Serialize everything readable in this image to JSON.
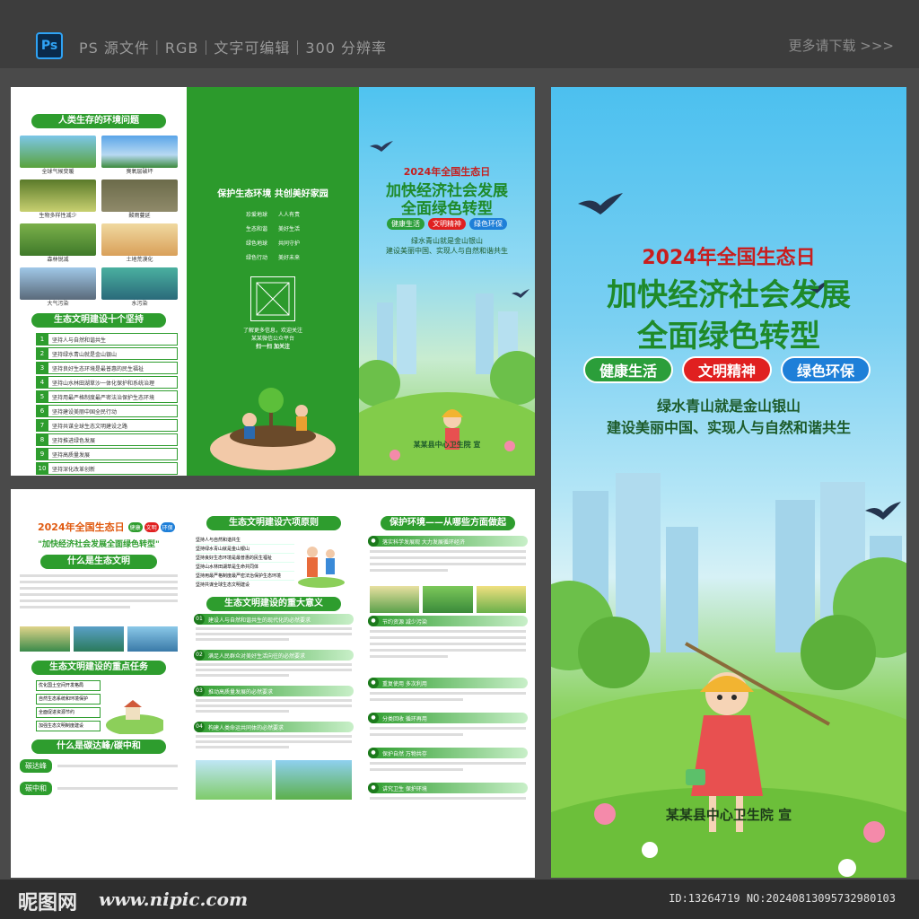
{
  "topbar": {
    "ps_badge": "Ps",
    "info": "PS 源文件｜RGB｜文字可编辑｜300 分辨率",
    "more": "更多请下载 >>>"
  },
  "bottombar": {
    "site_name": "昵图网",
    "site_url": "www.nipic.com",
    "id_text": "ID:13264719 NO:20240813095732980103"
  },
  "outside": {
    "left_panel": {
      "env_title": "人类生存的环境问题",
      "photos": [
        "全球气候变暖",
        "臭氧层破坏",
        "生物多样性减少",
        "酸雨蔓延",
        "森林锐减",
        "土地荒漠化",
        "大气污染",
        "水污染"
      ],
      "ten_title": "生态文明建设十个坚持",
      "ten_items": [
        "坚持人与自然和谐共生",
        "坚持绿水青山就是金山银山",
        "坚持良好生态环境是最普惠的民生福祉",
        "坚持山水林田湖草沙一体化保护和系统治理",
        "坚持用最严格制度最严密法治保护生态环境",
        "坚持建设美丽中国全民行动",
        "坚持共谋全球生态文明建设之路",
        "坚持推进绿色发展",
        "坚持高质量发展",
        "坚持深化改革创新"
      ]
    },
    "middle_panel": {
      "heading": "保护生态环境 共创美好家园",
      "pairs": [
        [
          "珍爱地球",
          "人人有责"
        ],
        [
          "生态和谐",
          "美好生活"
        ],
        [
          "绿色地球",
          "共同守护"
        ],
        [
          "绿色行动",
          "美好未来"
        ]
      ],
      "qr_note_1": "了解更多信息，欢迎关注",
      "qr_note_2": "某某微信公众平台",
      "qr_note_3": "扫一扫  加关注"
    },
    "cover_panel": {
      "year_title": "2024年全国生态日",
      "main_1": "加快经济社会发展",
      "main_2": "全面绿色转型",
      "tags": [
        "健康生活",
        "文明精神",
        "绿色环保"
      ],
      "slogan_1": "绿水青山就是金山银山",
      "slogan_2": "建设美丽中国、实现人与自然和谐共生",
      "issuer": "某某县中心卫生院  宣"
    }
  },
  "inside": {
    "p1": {
      "year_title": "2024年全国生态日",
      "badges": [
        "健康",
        "文明",
        "环保"
      ],
      "sub_title": "\"加快经济社会发展全面绿色转型\"",
      "what_title": "什么是生态文明",
      "key_title": "生态文明建设的重点任务",
      "key_items": [
        "优化国土空间开发格局",
        "自然生态系统和环境保护",
        "全面促进资源节约",
        "加强生态文明制度建设"
      ],
      "carbon_title": "什么是碳达峰/碳中和",
      "carbon_peak": "碳达峰",
      "carbon_neutral": "碳中和"
    },
    "p2": {
      "six_title": "生态文明建设六项原则",
      "six_items": [
        "坚持人与自然和谐共生",
        "坚持绿水青山就是金山银山",
        "坚持良好生态环境是最普惠的民生福祉",
        "坚持山水林田湖草是生命共同体",
        "坚持用最严格制度最严密法治保护生态环境",
        "坚持共谋全球生态文明建设"
      ],
      "meaning_title": "生态文明建设的重大意义",
      "meaning_items": [
        "建设人与自然和谐共生的现代化的必然要求",
        "满足人民群众对美好生活向往的必然要求",
        "推动高质量发展的必然要求",
        "构建人类命运共同体的必然要求"
      ]
    },
    "p3": {
      "protect_title": "保护环境——从哪些方面做起",
      "items": [
        "落实科学发展观  大力发展循环经济",
        "节约资源  减少污染",
        "重复使用  多次利用",
        "分类回收  循环再用",
        "保护自然  万物共存",
        "讲究卫生  保护环境"
      ]
    }
  },
  "poster": {
    "year_title": "2024年全国生态日",
    "main_1": "加快经济社会发展",
    "main_2": "全面绿色转型",
    "tags": [
      "健康生活",
      "文明精神",
      "绿色环保"
    ],
    "slogan_1": "绿水青山就是金山银山",
    "slogan_2": "建设美丽中国、实现人与自然和谐共生",
    "issuer": "某某县中心卫生院  宣"
  },
  "colors": {
    "green": "#2e9d2e",
    "sky": "#4cc0ef",
    "tag_green": "#2b9e3a",
    "tag_red": "#e02020",
    "tag_blue": "#1e7fd8"
  }
}
